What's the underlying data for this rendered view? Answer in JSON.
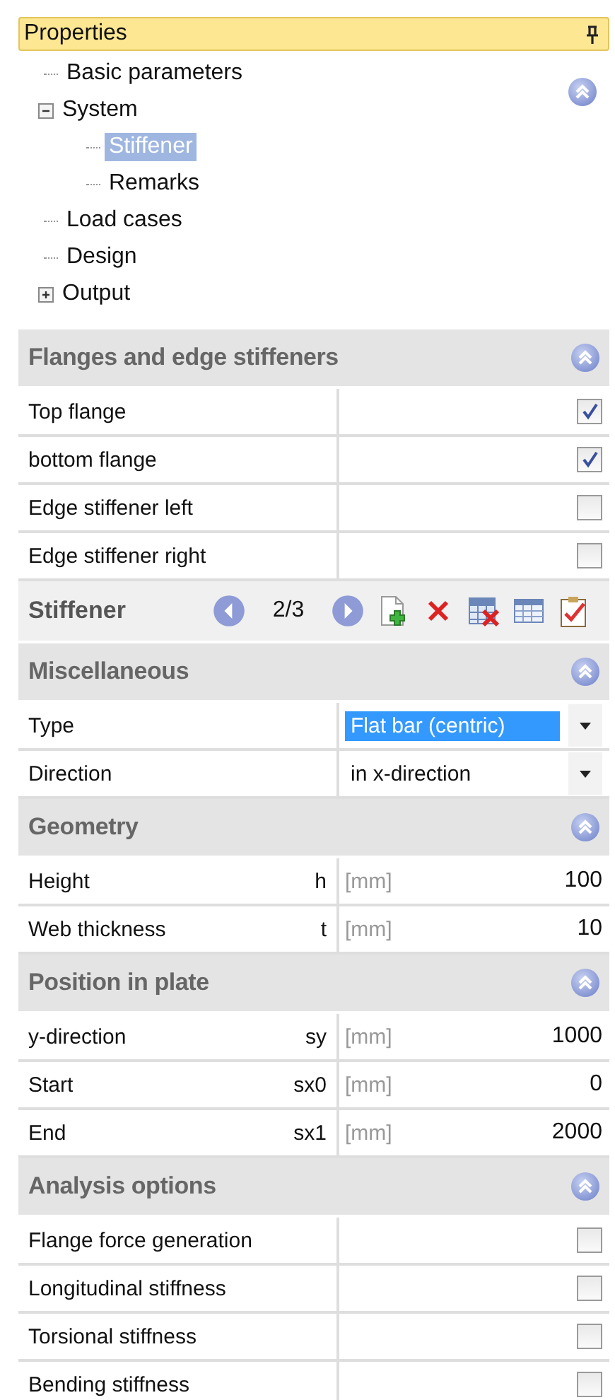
{
  "panel": {
    "title": "Properties"
  },
  "tree": [
    {
      "label": "Basic parameters",
      "selected": false
    },
    {
      "label": "System",
      "selected": false,
      "expanded": true,
      "children": [
        {
          "label": "Stiffener",
          "selected": true
        },
        {
          "label": "Remarks",
          "selected": false
        }
      ]
    },
    {
      "label": "Load cases",
      "selected": false
    },
    {
      "label": "Design",
      "selected": false
    },
    {
      "label": "Output",
      "selected": false,
      "expanded": false
    }
  ],
  "tree_collapsed": false,
  "groups": [
    {
      "kind": "section",
      "title": "Flanges and edge stiffeners",
      "expanded": true,
      "rows": [
        {
          "kind": "checkbox",
          "label": "Top flange",
          "checked": true
        },
        {
          "kind": "checkbox",
          "label": "bottom flange",
          "checked": true
        },
        {
          "kind": "checkbox",
          "label": "Edge stiffener left",
          "checked": false
        },
        {
          "kind": "checkbox",
          "label": "Edge stiffener right",
          "checked": false
        }
      ]
    },
    {
      "kind": "navigator",
      "label": "Stiffener",
      "counter": "2/3"
    },
    {
      "kind": "section",
      "title": "Miscellaneous",
      "expanded": true,
      "rows": [
        {
          "kind": "dropdown",
          "label": "Type",
          "value": "Flat bar (centric)",
          "focused": true
        },
        {
          "kind": "dropdown",
          "label": "Direction",
          "value": "in x-direction",
          "focused": false
        }
      ]
    },
    {
      "kind": "section",
      "title": "Geometry",
      "expanded": true,
      "rows": [
        {
          "kind": "number",
          "label": "Height",
          "symbol": "h",
          "unit": "[mm]",
          "value": "100"
        },
        {
          "kind": "number",
          "label": "Web thickness",
          "symbol": "t",
          "unit": "[mm]",
          "value": "10"
        }
      ]
    },
    {
      "kind": "section",
      "title": "Position in plate",
      "expanded": true,
      "rows": [
        {
          "kind": "number",
          "label": "y-direction",
          "symbol": "sy",
          "unit": "[mm]",
          "value": "1000"
        },
        {
          "kind": "number",
          "label": "Start",
          "symbol": "sx0",
          "unit": "[mm]",
          "value": "0"
        },
        {
          "kind": "number",
          "label": "End",
          "symbol": "sx1",
          "unit": "[mm]",
          "value": "2000"
        }
      ]
    },
    {
      "kind": "section",
      "title": "Analysis options",
      "expanded": true,
      "rows": [
        {
          "kind": "checkbox",
          "label": "Flange force generation",
          "checked": false
        },
        {
          "kind": "checkbox",
          "label": "Longitudinal stiffness",
          "checked": false
        },
        {
          "kind": "checkbox",
          "label": "Torsional stiffness",
          "checked": false
        },
        {
          "kind": "checkbox",
          "label": "Bending stiffness",
          "checked": false
        }
      ]
    }
  ]
}
